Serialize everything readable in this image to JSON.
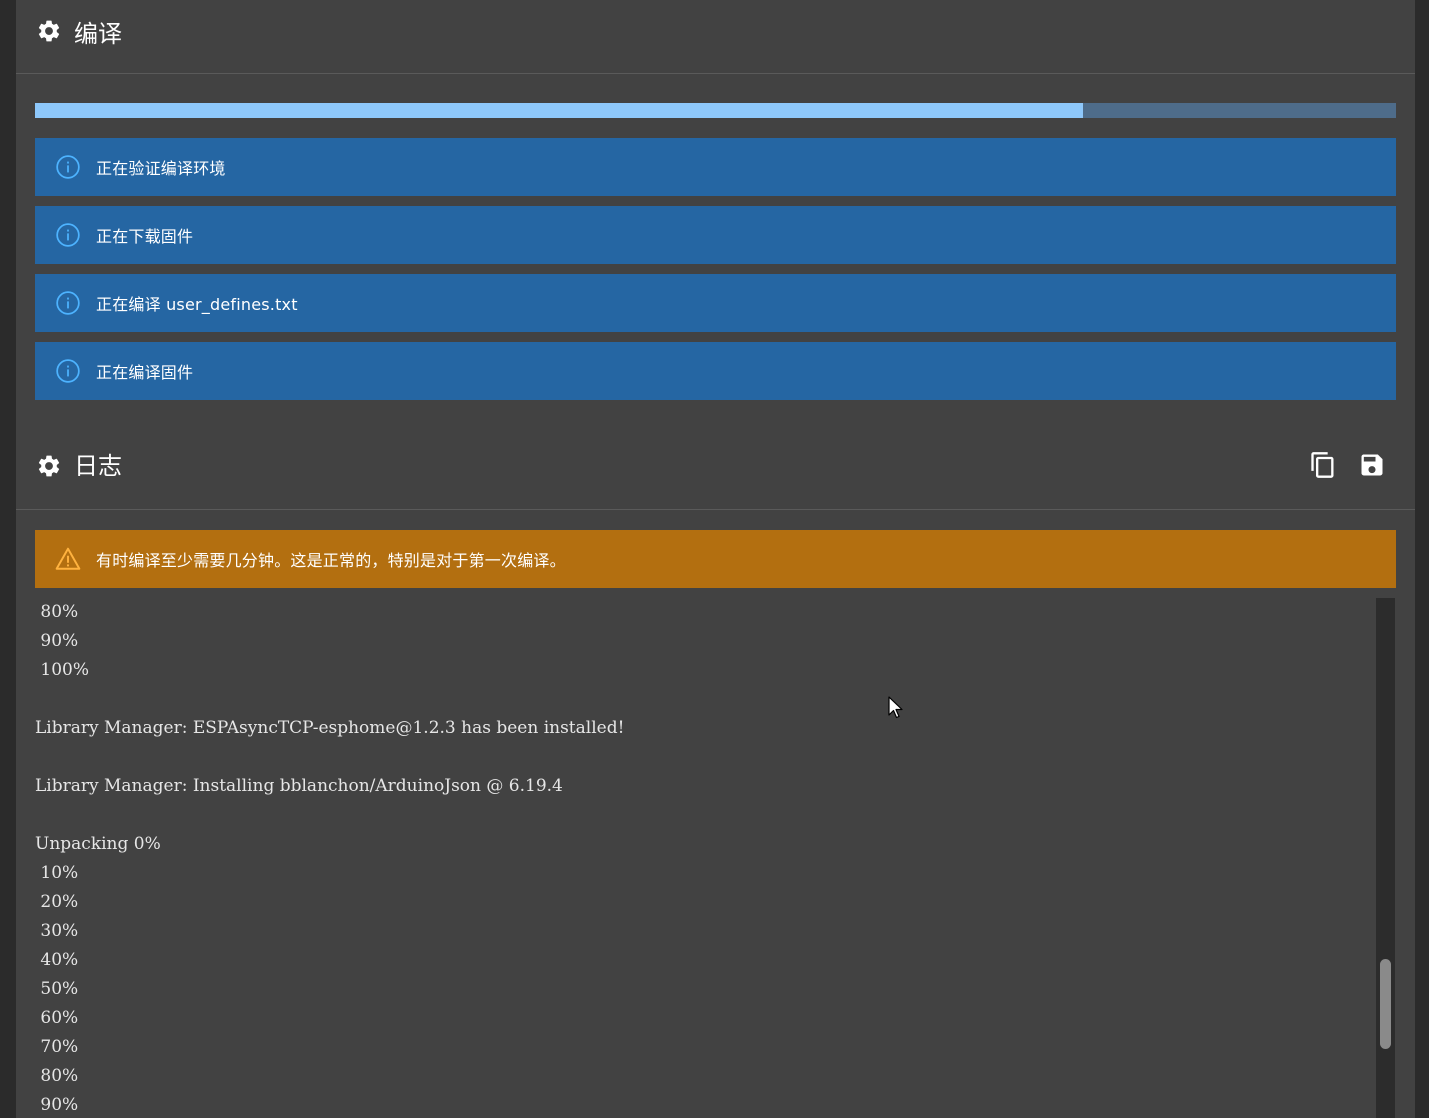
{
  "compile": {
    "title": "编译",
    "progress": 0.77,
    "steps": [
      {
        "text": "正在验证编译环境"
      },
      {
        "text": "正在下载固件"
      },
      {
        "text": "正在编译 user_defines.txt"
      },
      {
        "text": "正在编译固件"
      }
    ]
  },
  "log": {
    "title": "日志",
    "copy_icon": "copy-icon",
    "save_icon": "save-icon",
    "warning": "有时编译至少需要几分钟。这是正常的，特别是对于第一次编译。",
    "lines": [
      " 80%",
      " 90%",
      " 100%",
      "",
      "Library Manager: ESPAsyncTCP-esphome@1.2.3 has been installed!",
      "",
      "Library Manager: Installing bblanchon/ArduinoJson @ 6.19.4",
      "",
      "Unpacking 0%",
      " 10%",
      " 20%",
      " 30%",
      " 40%",
      " 50%",
      " 60%",
      " 70%",
      " 80%",
      " 90%"
    ],
    "scroll_position": 0.84
  },
  "colors": {
    "info": "#2566a3",
    "warning": "#b36f10",
    "progress_fill": "#8ec8fb",
    "progress_track": "#4e6c8a",
    "panel": "#424242"
  }
}
